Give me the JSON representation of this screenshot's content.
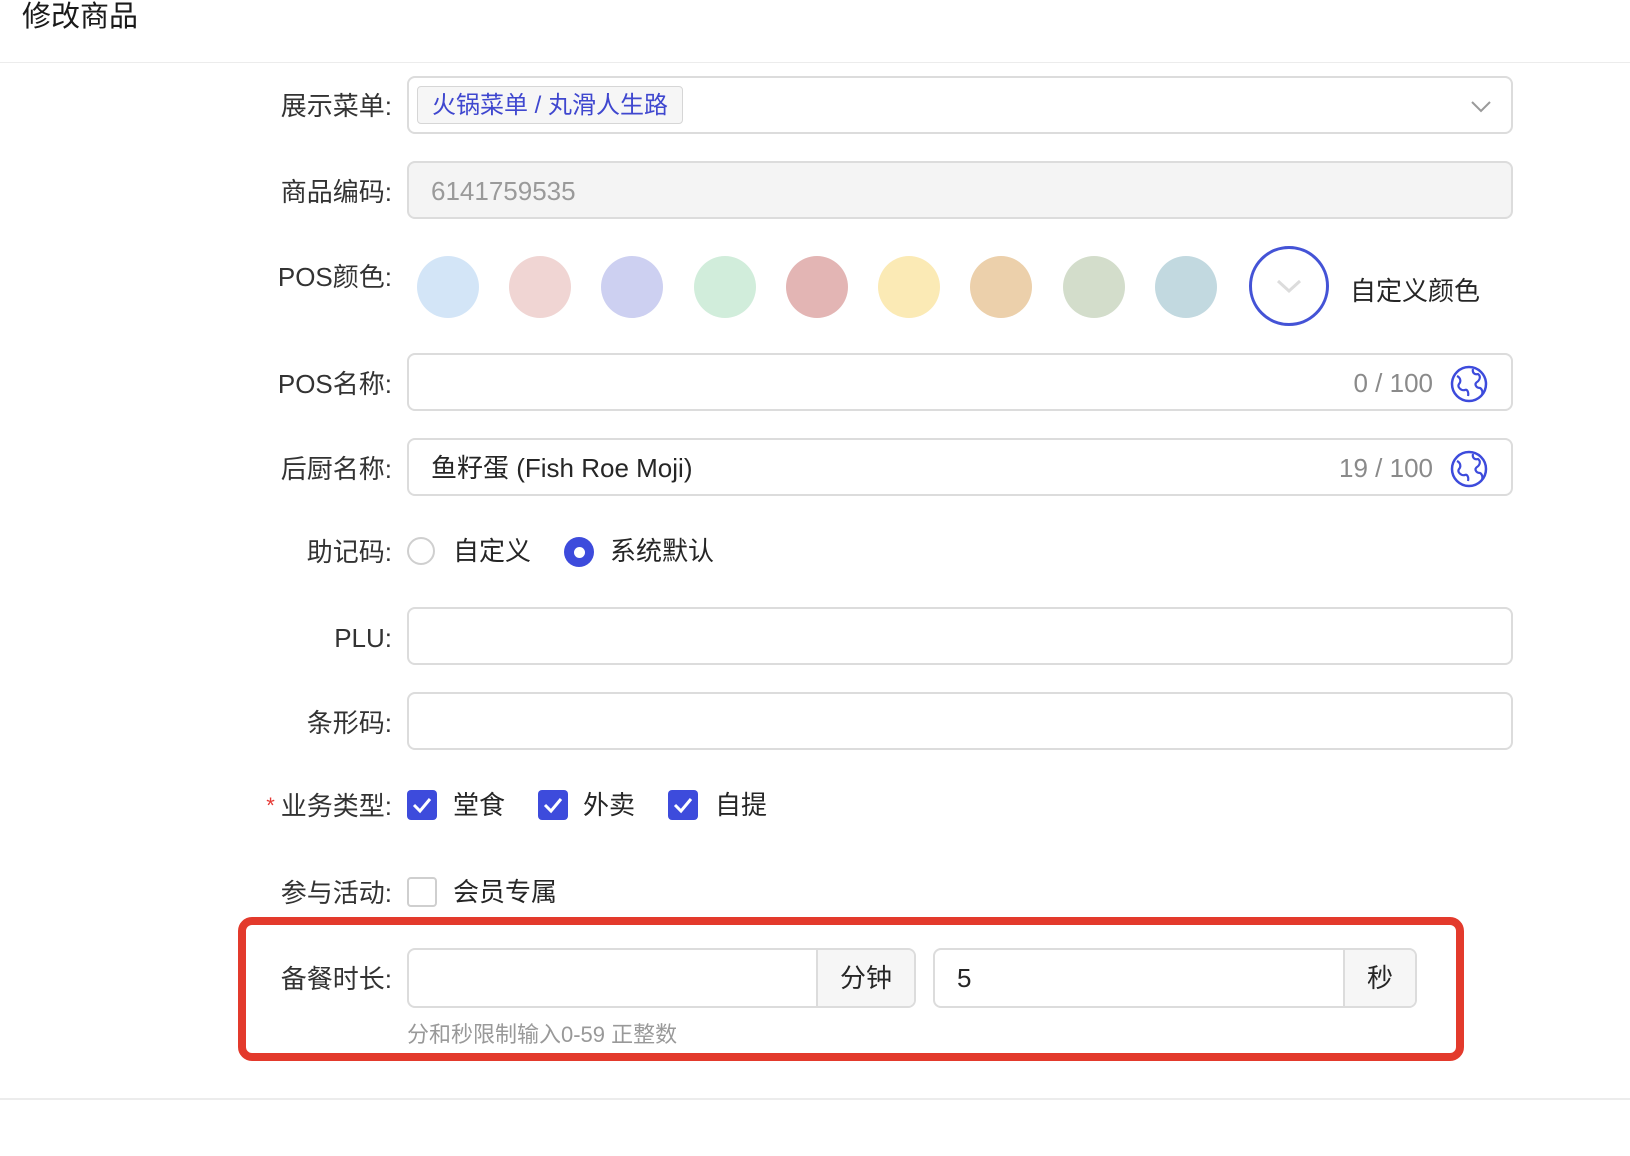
{
  "page": {
    "title": "修改商品"
  },
  "form": {
    "display_menu": {
      "label": "展示菜单:",
      "tag": "火锅菜单 / 丸滑人生路"
    },
    "product_code": {
      "label": "商品编码:",
      "value": "6141759535"
    },
    "pos_color": {
      "label": "POS颜色:",
      "swatches": [
        "#d3e5f7",
        "#f0d5d3",
        "#cdd0f1",
        "#d1eddb",
        "#e3b5b4",
        "#fbeab5",
        "#ecd0ab",
        "#d3ddcb",
        "#c2d9e0"
      ],
      "custom_label": "自定义颜色",
      "ring_color": "#4453d6"
    },
    "pos_name": {
      "label": "POS名称:",
      "value": "",
      "counter": "0 / 100"
    },
    "kitchen_name": {
      "label": "后厨名称:",
      "value": "鱼籽蛋 (Fish Roe Moji)",
      "counter": "19 / 100"
    },
    "mnemonic": {
      "label": "助记码:",
      "options": [
        {
          "label": "自定义",
          "checked": false
        },
        {
          "label": "系统默认",
          "checked": true
        }
      ]
    },
    "plu": {
      "label": "PLU:",
      "value": ""
    },
    "barcode": {
      "label": "条形码:",
      "value": ""
    },
    "business_type": {
      "required_mark": "*",
      "label": "业务类型:",
      "options": [
        {
          "label": "堂食",
          "checked": true
        },
        {
          "label": "外卖",
          "checked": true
        },
        {
          "label": "自提",
          "checked": true
        }
      ]
    },
    "activity": {
      "label": "参与活动:",
      "options": [
        {
          "label": "会员专属",
          "checked": false
        }
      ]
    },
    "prep_time": {
      "label": "备餐时长:",
      "minutes_value": "",
      "minutes_unit": "分钟",
      "seconds_value": "5",
      "seconds_unit": "秒",
      "hint": "分和秒限制输入0-59 正整数"
    }
  },
  "colors": {
    "accent": "#3d4bdc",
    "highlight": "#e33a2c",
    "required": "#e53935"
  }
}
